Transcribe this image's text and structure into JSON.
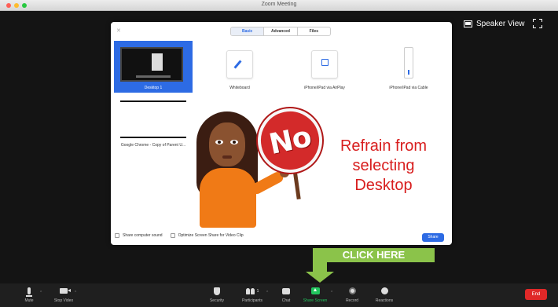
{
  "window": {
    "title": "Zoom Meeting"
  },
  "top_right": {
    "speaker_view_label": "Speaker View"
  },
  "share_dialog": {
    "tabs": [
      "Basic",
      "Advanced",
      "Files"
    ],
    "active_tab": "Basic",
    "tiles": [
      {
        "label": "Desktop 1",
        "selected": true
      },
      {
        "label": "Whiteboard"
      },
      {
        "label": "iPhone/iPad via AirPlay"
      },
      {
        "label": "iPhone/iPad via Cable"
      },
      {
        "label": "Google Chrome - Copy of Parent U..."
      }
    ],
    "options": {
      "share_sound": "Share computer sound",
      "optimize_video": "Optimize Screen Share for Video Clip"
    },
    "share_button": "Share"
  },
  "annotation": {
    "sign_text": "No",
    "message": [
      "Refrain from",
      "selecting",
      "Desktop"
    ],
    "click_here": "CLICK HERE"
  },
  "toolbar": {
    "mute": "Mute",
    "stop_video": "Stop Video",
    "security": "Security",
    "participants": "Participants",
    "participants_count": "1",
    "chat": "Chat",
    "share_screen": "Share Screen",
    "record": "Record",
    "reactions": "Reactions",
    "end": "End"
  },
  "colors": {
    "accent": "#2d6be4",
    "share_green": "#22c55e",
    "end_red": "#e02828",
    "annotation_red": "#d81e1e",
    "click_here_green": "#8bc34a"
  },
  "icons": [
    "mic-icon",
    "video-icon",
    "shield-icon",
    "participants-icon",
    "chat-icon",
    "share-screen-icon",
    "record-icon",
    "reactions-icon",
    "speaker-view-icon",
    "fullscreen-icon"
  ]
}
